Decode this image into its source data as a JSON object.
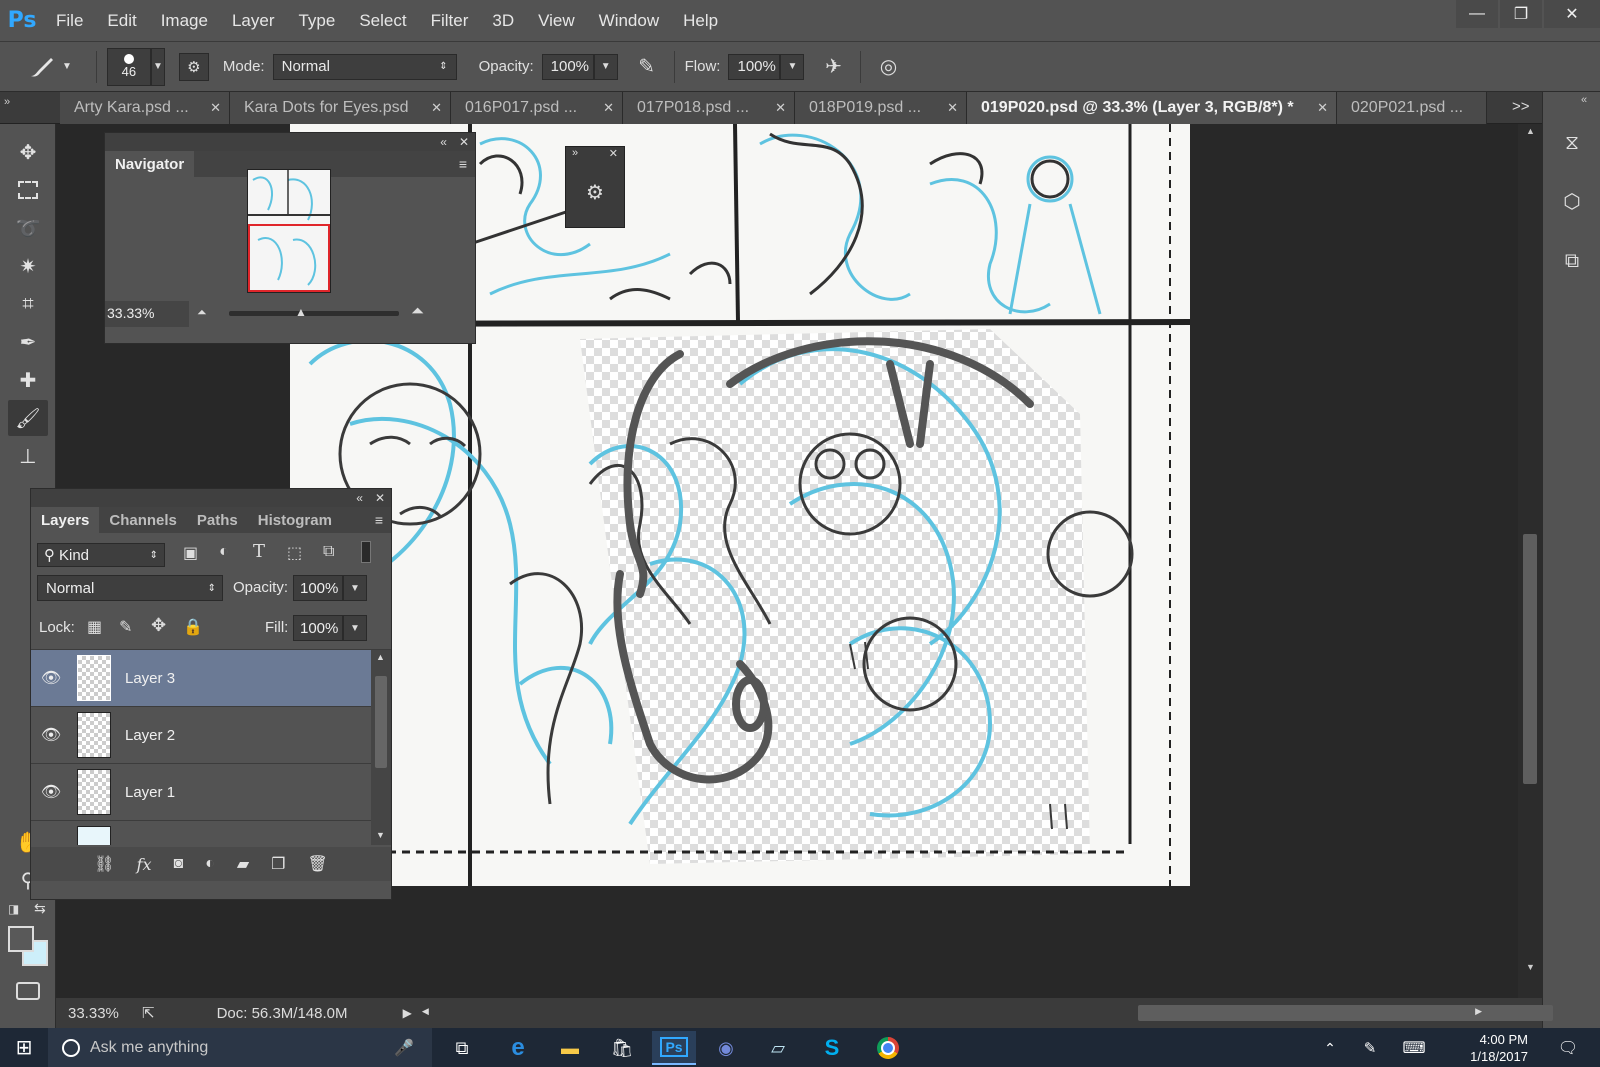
{
  "app": {
    "logo": "Ps"
  },
  "menu": [
    "File",
    "Edit",
    "Image",
    "Layer",
    "Type",
    "Select",
    "Filter",
    "3D",
    "View",
    "Window",
    "Help"
  ],
  "window_controls": {
    "minimize": "—",
    "restore": "❐",
    "close": "✕"
  },
  "options": {
    "brush_size": "46",
    "mode_label": "Mode:",
    "mode_value": "Normal",
    "opacity_label": "Opacity:",
    "opacity_value": "100%",
    "flow_label": "Flow:",
    "flow_value": "100%"
  },
  "tabs": [
    {
      "label": "Arty Kara.psd ...",
      "active": false
    },
    {
      "label": "Kara Dots for Eyes.psd",
      "active": false
    },
    {
      "label": "016P017.psd ...",
      "active": false
    },
    {
      "label": "017P018.psd ...",
      "active": false
    },
    {
      "label": "018P019.psd ...",
      "active": false
    },
    {
      "label": "019P020.psd @ 33.3% (Layer 3, RGB/8*) *",
      "active": true
    },
    {
      "label": "020P021.psd ...",
      "active": false
    }
  ],
  "tabs_overflow": ">>",
  "navigator": {
    "title": "Navigator",
    "zoom": "33.33%"
  },
  "layers_panel": {
    "tabs": [
      "Layers",
      "Channels",
      "Paths",
      "Histogram"
    ],
    "filter_kind": "Kind",
    "blend_mode": "Normal",
    "opacity_label": "Opacity:",
    "opacity_value": "100%",
    "lock_label": "Lock:",
    "fill_label": "Fill:",
    "fill_value": "100%",
    "layers": [
      {
        "name": "Layer 3",
        "active": true
      },
      {
        "name": "Layer 2",
        "active": false
      },
      {
        "name": "Layer 1",
        "active": false
      }
    ]
  },
  "status": {
    "zoom": "33.33%",
    "doc": "Doc: 56.3M/148.0M"
  },
  "taskbar": {
    "search_placeholder": "Ask me anything",
    "time": "4:00 PM",
    "date": "1/18/2017"
  },
  "colors": {
    "ui_bg": "#535353",
    "dark_bg": "#282828",
    "active_layer": "#6b7a95",
    "ps_blue": "#31a8ff",
    "sketch_blue": "#5ec3e0",
    "sketch_dark": "#3a3a3a"
  }
}
